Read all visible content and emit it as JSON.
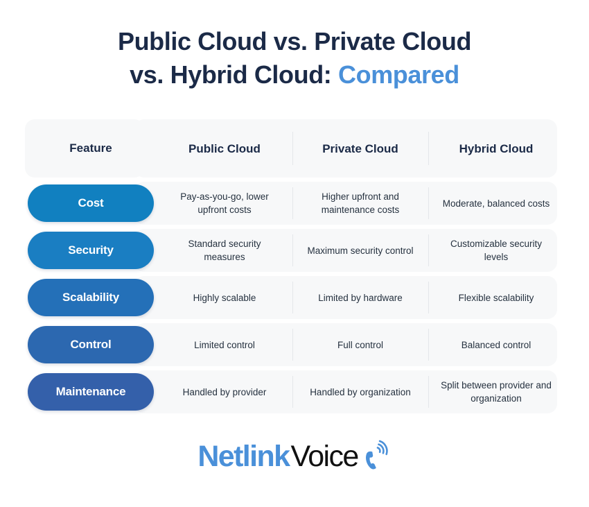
{
  "title": {
    "line1": "Public Cloud vs. Private Cloud",
    "line2_main": "vs. Hybrid Cloud:",
    "line2_accent": "Compared",
    "color": "#1b2a47",
    "accent_color": "#4a90d9"
  },
  "table": {
    "columns": [
      "Feature",
      "Public Cloud",
      "Private Cloud",
      "Hybrid Cloud"
    ],
    "rows": [
      {
        "feature": "Cost",
        "pill_color": "#1180c0",
        "public": "Pay-as-you-go, lower upfront costs",
        "private": "Higher upfront and maintenance costs",
        "hybrid": "Moderate, balanced costs"
      },
      {
        "feature": "Security",
        "pill_color": "#1a7ec2",
        "public": "Standard security measures",
        "private": "Maximum security control",
        "hybrid": "Customizable security levels"
      },
      {
        "feature": "Scalability",
        "pill_color": "#2470b8",
        "public": "Highly scalable",
        "private": "Limited by hardware",
        "hybrid": "Flexible scalability"
      },
      {
        "feature": "Control",
        "pill_color": "#2c68b0",
        "public": "Limited control",
        "private": "Full control",
        "hybrid": "Balanced control"
      },
      {
        "feature": "Maintenance",
        "pill_color": "#3460aa",
        "public": "Handled by provider",
        "private": "Handled by organization",
        "hybrid": "Split between provider and organization"
      }
    ]
  },
  "logo": {
    "brand_primary": "Netlink",
    "brand_secondary": "Voice",
    "primary_color": "#4a90d9",
    "secondary_color": "#111111",
    "icon": "phone-handset-icon"
  }
}
